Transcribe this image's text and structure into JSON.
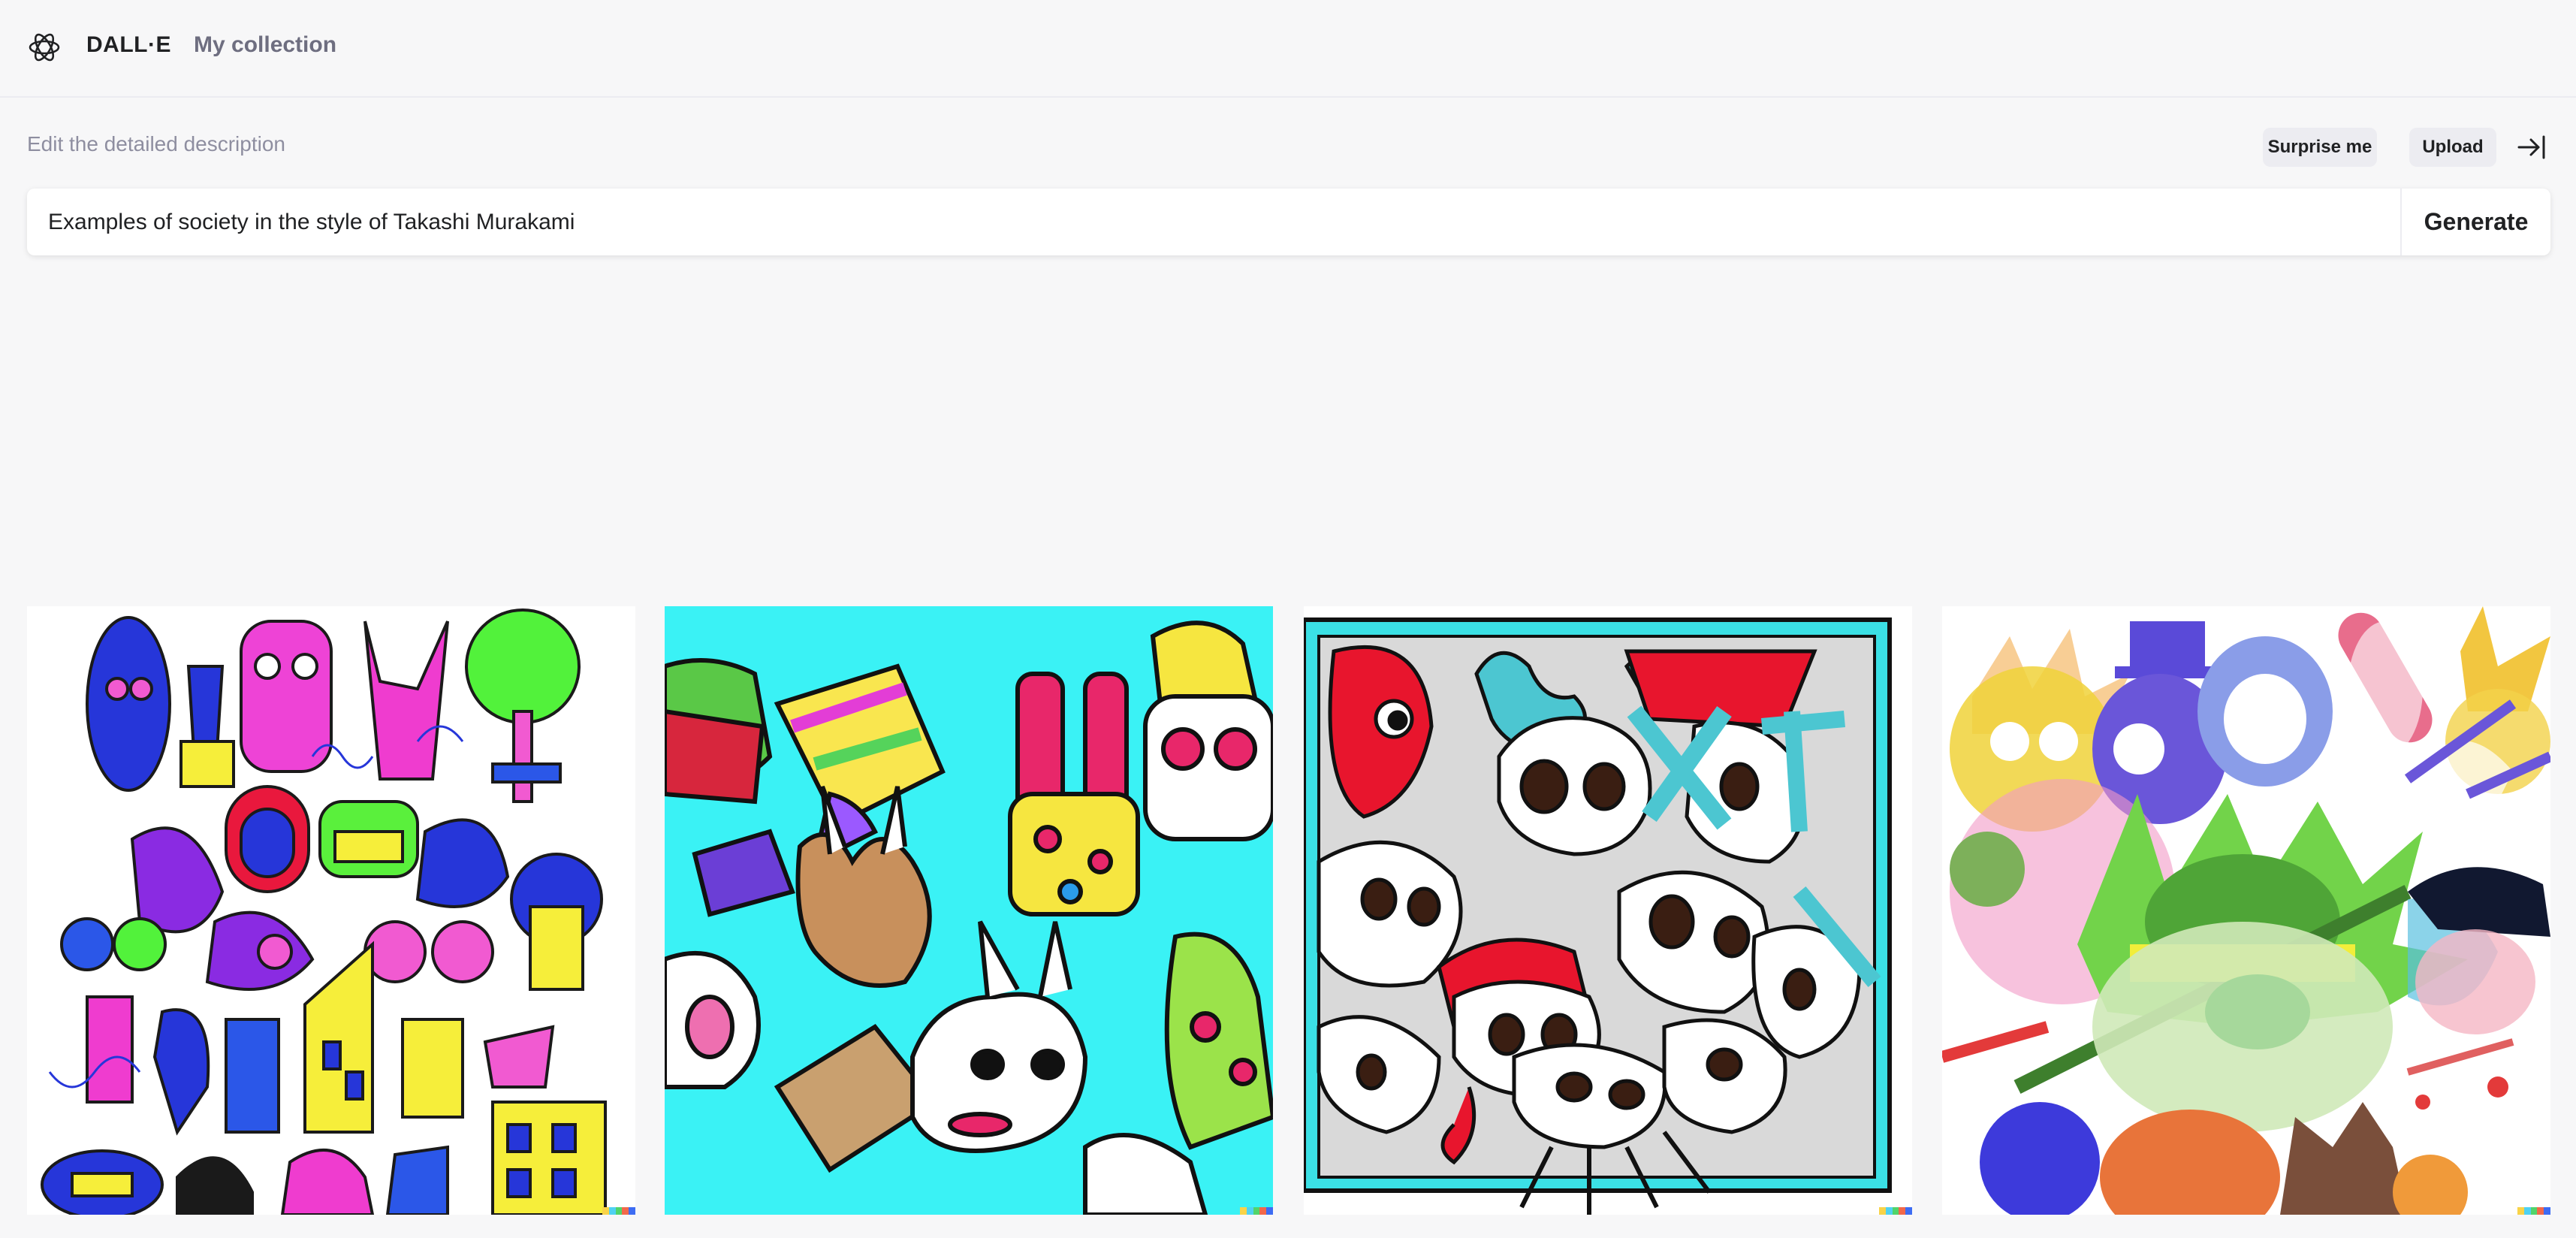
{
  "header": {
    "brand": "DALL·E",
    "nav_link": "My collection"
  },
  "prompt": {
    "label": "Edit the detailed description",
    "value": "Examples of society in the style of Takashi Murakami",
    "surprise_label": "Surprise me",
    "upload_label": "Upload",
    "generate_label": "Generate"
  },
  "icons": {
    "logo": "openai-logo-icon",
    "collapse": "arrow-right-to-bar-icon"
  },
  "results": [
    {
      "name": "generated-image-1"
    },
    {
      "name": "generated-image-2"
    },
    {
      "name": "generated-image-3"
    },
    {
      "name": "generated-image-4"
    }
  ],
  "colors": {
    "background": "#f7f7f8",
    "chip": "#ececf1",
    "text": "#202123",
    "muted": "#8e8ea0",
    "signature": [
      "#f9d348",
      "#4fd1f2",
      "#51d46a",
      "#f2684a",
      "#3d6cf3"
    ]
  }
}
